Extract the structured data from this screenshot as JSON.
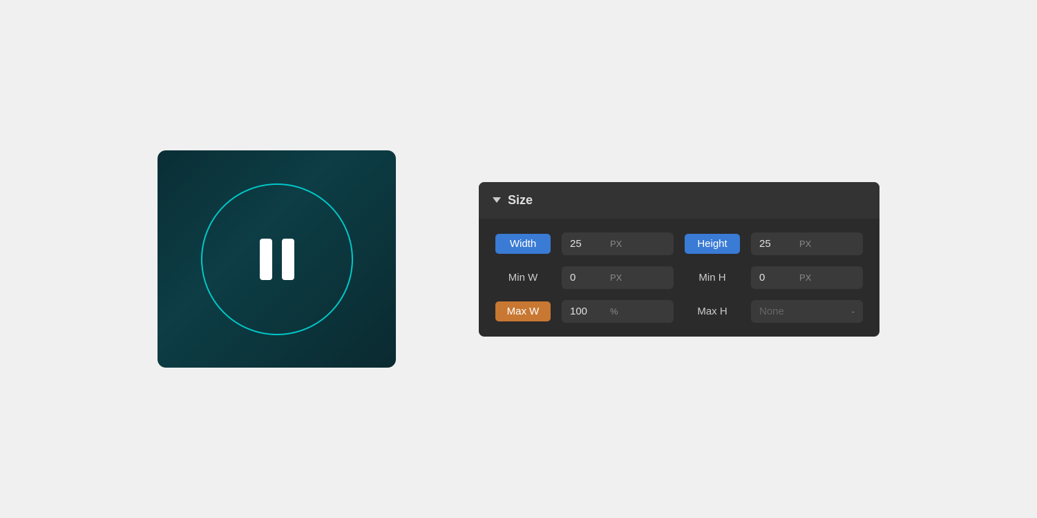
{
  "preview": {
    "background_color_start": "#0a2e35",
    "background_color_end": "#0a2a30",
    "circle_color": "#00c8c8",
    "pause_bar_color": "#ffffff"
  },
  "size_panel": {
    "header": {
      "title": "Size",
      "chevron_icon": "chevron-down-icon"
    },
    "rows": [
      {
        "left_label": "Width",
        "left_label_style": "blue",
        "left_value": "25",
        "left_unit": "PX",
        "right_label": "Height",
        "right_label_style": "blue",
        "right_value": "25",
        "right_unit": "PX"
      },
      {
        "left_label": "Min W",
        "left_label_style": "plain",
        "left_value": "0",
        "left_unit": "PX",
        "right_label": "Min H",
        "right_label_style": "plain",
        "right_value": "0",
        "right_unit": "PX"
      },
      {
        "left_label": "Max W",
        "left_label_style": "orange",
        "left_value": "100",
        "left_unit": "%",
        "right_label": "Max H",
        "right_label_style": "plain",
        "right_value": "None",
        "right_unit": "-"
      }
    ]
  }
}
